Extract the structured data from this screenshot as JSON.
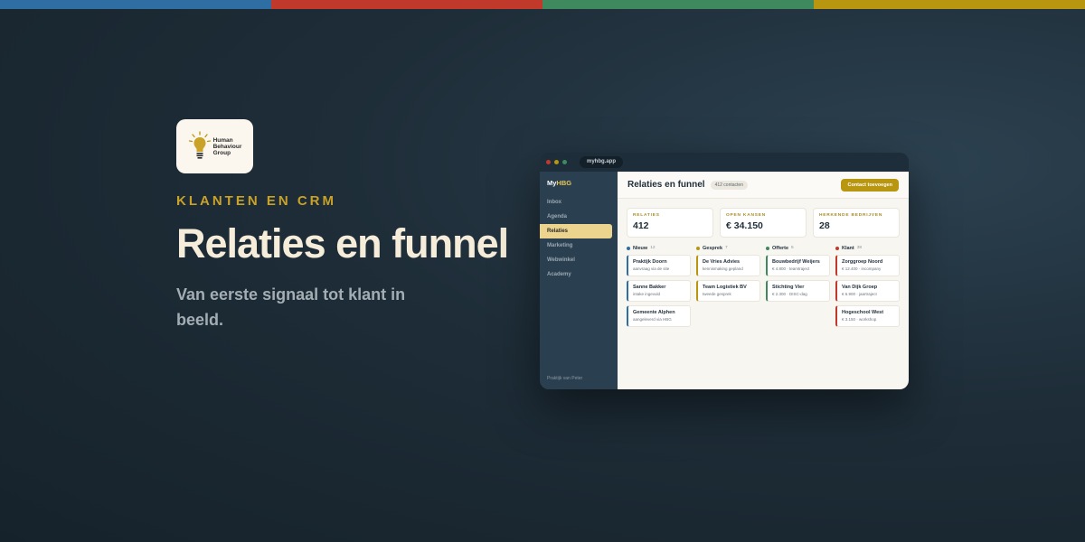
{
  "accent_colors": {
    "blue": "#2e6ea3",
    "red": "#c0392b",
    "green": "#3e8a5e",
    "gold": "#b8960f"
  },
  "logo": {
    "icon": "lightbulb-icon",
    "lines": [
      "Human",
      "Behaviour",
      "Group"
    ]
  },
  "hero": {
    "eyebrow": "KLANTEN EN CRM",
    "title": "Relaties en funnel",
    "subtitle": "Van eerste signaal tot klant in beeld."
  },
  "app": {
    "url": "myhbg.app",
    "brand_prefix": "My",
    "brand_suffix": "HBG",
    "nav": [
      "Inbox",
      "Agenda",
      "Relaties",
      "Marketing",
      "Webwinkel",
      "Academy"
    ],
    "active_nav": "Relaties",
    "sidebar_footer": "Praktijk van Peter",
    "page_title": "Relaties en funnel",
    "contacts_count": "412 contacten",
    "add_button": "Contact toevoegen",
    "stats": [
      {
        "label": "RELATIES",
        "value": "412"
      },
      {
        "label": "OPEN KANSEN",
        "value": "€ 34.150"
      },
      {
        "label": "HERKENDE BEDRIJVEN",
        "value": "28"
      }
    ],
    "columns": [
      {
        "name": "Nieuw",
        "count": "12",
        "color": "#2e6ea3",
        "cards": [
          {
            "title": "Praktijk Doorn",
            "sub": "aanvraag via de site"
          },
          {
            "title": "Sanne Bakker",
            "sub": "intake ingevuld"
          },
          {
            "title": "Gemeente Alphen",
            "sub": "aangeleverd via HBG"
          }
        ]
      },
      {
        "name": "Gesprek",
        "count": "7",
        "color": "#b8960f",
        "cards": [
          {
            "title": "De Vries Advies",
            "sub": "kennismaking gepland"
          },
          {
            "title": "Team Logistiek BV",
            "sub": "tweede gesprek"
          }
        ]
      },
      {
        "name": "Offerte",
        "count": "5",
        "color": "#3e8a5e",
        "cards": [
          {
            "title": "Bouwbedrijf Weijers",
            "sub": "€ 4.800 · teamtraject"
          },
          {
            "title": "Stichting Vier",
            "sub": "€ 2.300 · DISC-dag"
          }
        ]
      },
      {
        "name": "Klant",
        "count": "38",
        "color": "#c0392b",
        "cards": [
          {
            "title": "Zorggroep Noord",
            "sub": "€ 12.400 · incompany"
          },
          {
            "title": "Van Dijk Groep",
            "sub": "€ 6.900 · jaartraject"
          },
          {
            "title": "Hogeschool West",
            "sub": "€ 3.150 · workshop"
          }
        ]
      }
    ]
  }
}
